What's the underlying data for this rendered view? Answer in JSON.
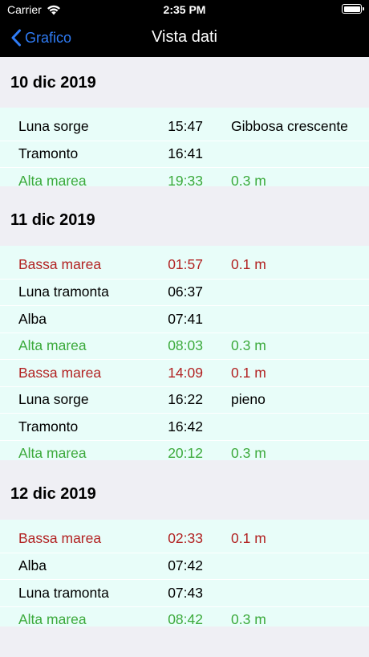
{
  "status": {
    "carrier": "Carrier",
    "time": "2:35 PM"
  },
  "nav": {
    "back_label": "Grafico",
    "title": "Vista dati"
  },
  "sections": [
    {
      "date": "10 dic 2019",
      "rows": [
        {
          "label": "Luna sorge",
          "time": "15:47",
          "info": "Gibbosa crescente",
          "kind": "normal"
        },
        {
          "label": "Tramonto",
          "time": "16:41",
          "info": "",
          "kind": "normal"
        },
        {
          "label": "Alta marea",
          "time": "19:33",
          "info": "0.3 m",
          "kind": "high"
        }
      ]
    },
    {
      "date": "11 dic 2019",
      "rows": [
        {
          "label": "Bassa marea",
          "time": "01:57",
          "info": "0.1 m",
          "kind": "low"
        },
        {
          "label": "Luna tramonta",
          "time": "06:37",
          "info": "",
          "kind": "normal"
        },
        {
          "label": "Alba",
          "time": "07:41",
          "info": "",
          "kind": "normal"
        },
        {
          "label": "Alta marea",
          "time": "08:03",
          "info": "0.3 m",
          "kind": "high"
        },
        {
          "label": "Bassa marea",
          "time": "14:09",
          "info": "0.1 m",
          "kind": "low"
        },
        {
          "label": "Luna sorge",
          "time": "16:22",
          "info": "pieno",
          "kind": "normal"
        },
        {
          "label": "Tramonto",
          "time": "16:42",
          "info": "",
          "kind": "normal"
        },
        {
          "label": "Alta marea",
          "time": "20:12",
          "info": "0.3 m",
          "kind": "high"
        }
      ]
    },
    {
      "date": "12 dic 2019",
      "rows": [
        {
          "label": "Bassa marea",
          "time": "02:33",
          "info": "0.1 m",
          "kind": "low"
        },
        {
          "label": "Alba",
          "time": "07:42",
          "info": "",
          "kind": "normal"
        },
        {
          "label": "Luna tramonta",
          "time": "07:43",
          "info": "",
          "kind": "normal"
        },
        {
          "label": "Alta marea",
          "time": "08:42",
          "info": "0.3 m",
          "kind": "high"
        }
      ]
    }
  ],
  "colors": {
    "accent": "#2f7cf6",
    "high_tide": "#3caa3c",
    "low_tide": "#b22222",
    "row_bg": "#e8fdf9"
  }
}
